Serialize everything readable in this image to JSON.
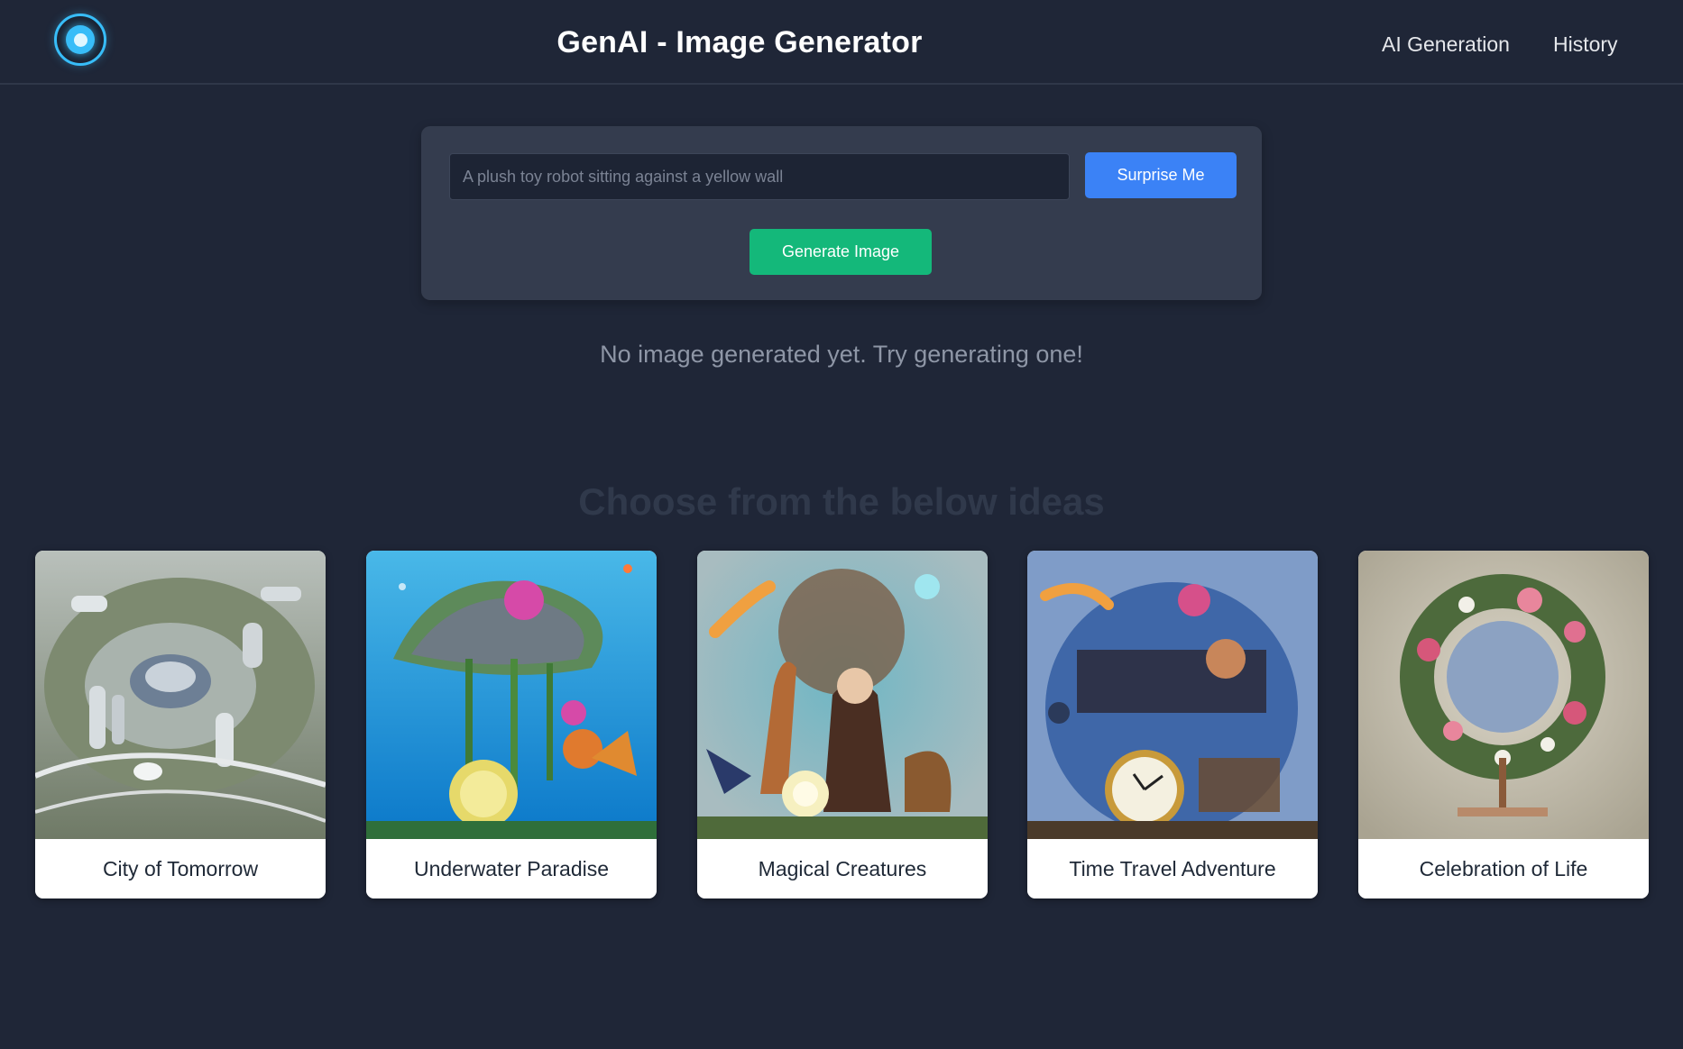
{
  "header": {
    "title": "GenAI - Image Generator",
    "nav": [
      "AI Generation",
      "History"
    ]
  },
  "prompt": {
    "placeholder": "A plush toy robot sitting against a yellow wall",
    "value": "",
    "surprise_label": "Surprise Me",
    "generate_label": "Generate Image"
  },
  "status": {
    "empty_message": "No image generated yet. Try generating one!"
  },
  "ideas": {
    "heading": "Choose from the below ideas",
    "cards": [
      {
        "label": "City of Tomorrow"
      },
      {
        "label": "Underwater Paradise"
      },
      {
        "label": "Magical Creatures"
      },
      {
        "label": "Time Travel Adventure"
      },
      {
        "label": "Celebration of Life"
      }
    ]
  },
  "colors": {
    "background": "#1f2637",
    "panel": "#343c4e",
    "accent_blue": "#3b82f6",
    "accent_green": "#14b87a",
    "logo": "#38bdf8"
  }
}
